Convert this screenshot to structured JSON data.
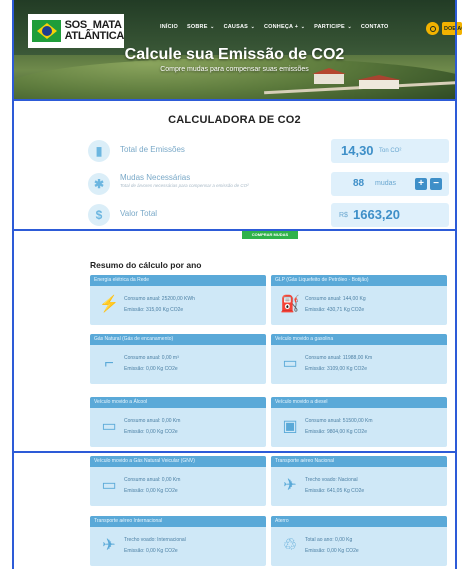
{
  "header": {
    "logo_text_line1": "SOS_MATA",
    "logo_text_line2": "ATLÂNTICA",
    "nav": [
      {
        "label": "INÍCIO",
        "has_dropdown": false
      },
      {
        "label": "SOBRE",
        "has_dropdown": true
      },
      {
        "label": "CAUSAS",
        "has_dropdown": true
      },
      {
        "label": "CONHEÇA +",
        "has_dropdown": true
      },
      {
        "label": "PARTICIPE",
        "has_dropdown": true
      },
      {
        "label": "CONTATO",
        "has_dropdown": false
      }
    ],
    "donate_label": "DOE AGO",
    "accent_color": "#f2b200"
  },
  "hero": {
    "title": "Calcule sua Emissão de CO2",
    "subtitle": "Compre mudas para compensar suas emissões"
  },
  "calculator": {
    "title": "CALCULADORA DE CO2",
    "rows": [
      {
        "icon": "bar-chart-icon",
        "label": "Total de Emissões",
        "value": "14,30",
        "unit": "Ton CO²"
      },
      {
        "icon": "tree-icon",
        "label": "Mudas Necessárias",
        "sublabel": "Total de árvores necessárias para compensar a emissão de CO²",
        "value": "88",
        "unit": "mudas",
        "plus": "+",
        "minus": "−"
      },
      {
        "icon": "dollar-icon",
        "label": "Valor Total",
        "currency": "R$",
        "value": "1663,20"
      }
    ],
    "buy_button": "COMPRAR MUDAS"
  },
  "summary": {
    "title": "Resumo do cálculo por ano",
    "cards": [
      {
        "head": "Energia elétrica da Rede",
        "icon": "plug-icon",
        "line1": "Consumo anual: 25200,00 KWh",
        "line2": "Emissão: 315,00 Kg CO2e"
      },
      {
        "head": "GLP (Gás Liquefeito de Petróleo - Botijão)",
        "icon": "gas-cylinder-icon",
        "line1": "Consumo anual: 144,00 Kg",
        "line2": "Emissão: 430,71 Kg CO2e"
      },
      {
        "head": "Gás Natural (Gás de encanamento)",
        "icon": "pipe-icon",
        "line1": "Consumo anual: 0,00 m³",
        "line2": "Emissão: 0,00 Kg CO2e"
      },
      {
        "head": "Veículo movido a gasolina",
        "icon": "car-icon",
        "line1": "Consumo anual: 11988,00 Km",
        "line2": "Emissão: 3109,00 Kg CO2e"
      },
      {
        "head": "Veículo movido a Álcool",
        "icon": "car-icon",
        "line1": "Consumo anual: 0,00 Km",
        "line2": "Emissão: 0,00 Kg CO2e"
      },
      {
        "head": "Veículo movido a diesel",
        "icon": "bus-icon",
        "line1": "Consumo anual: 51500,00 Km",
        "line2": "Emissão: 9804,00 Kg CO2e"
      },
      {
        "head": "Veículo movido a Gás Natural Veicular (GNV)",
        "icon": "car-icon",
        "line1": "Consumo anual: 0,00 Km",
        "line2": "Emissão: 0,00 Kg CO2e"
      },
      {
        "head": "Transporte aéreo Nacional",
        "icon": "airplane-icon",
        "line1": "Trecho voado: Nacional",
        "line2": "Emissão: 641,05 Kg CO2e"
      },
      {
        "head": "Transporte aéreo Internacional",
        "icon": "airplane-icon",
        "line1": "Trecho voado: Internacional",
        "line2": "Emissão: 0,00 Kg CO2e"
      },
      {
        "head": "Aterro",
        "icon": "landfill-icon",
        "line1": "Total ao ano: 0,00 Kg",
        "line2": "Emissão: 0,00 Kg CO2e"
      }
    ]
  }
}
